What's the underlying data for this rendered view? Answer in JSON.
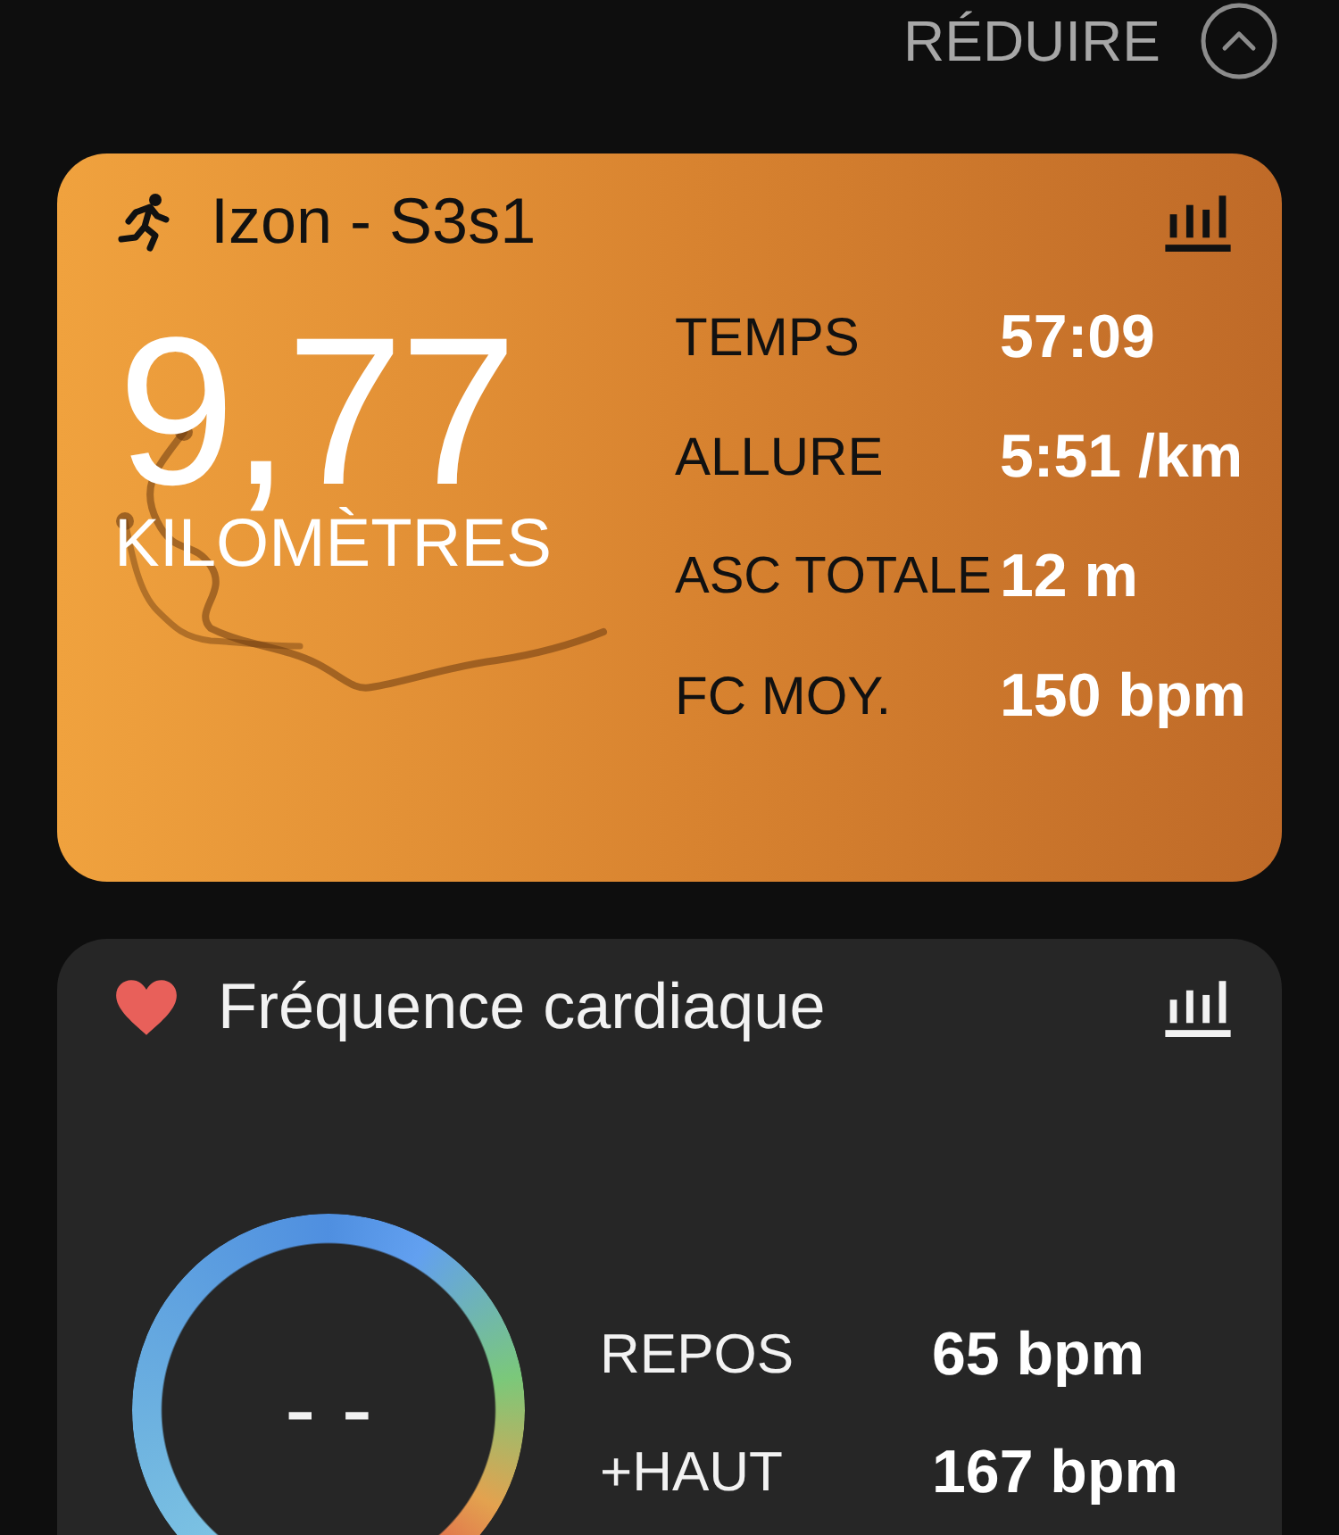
{
  "header": {
    "collapse_label": "RÉDUIRE"
  },
  "activity": {
    "title": "Izon - S3s1",
    "distance": "9,77",
    "distance_unit": "KILOMÈTRES",
    "stats": [
      {
        "label": "TEMPS",
        "value": "57:09"
      },
      {
        "label": "ALLURE",
        "value": "5:51 /km"
      },
      {
        "label": "ASC TOTALE",
        "value": "12 m"
      },
      {
        "label": "FC MOY.",
        "value": "150 bpm"
      }
    ]
  },
  "heart_rate": {
    "title": "Fréquence cardiaque",
    "current": "- -",
    "stats": [
      {
        "label": "REPOS",
        "value": "65 bpm"
      },
      {
        "label": "+HAUT",
        "value": "167 bpm"
      }
    ]
  }
}
